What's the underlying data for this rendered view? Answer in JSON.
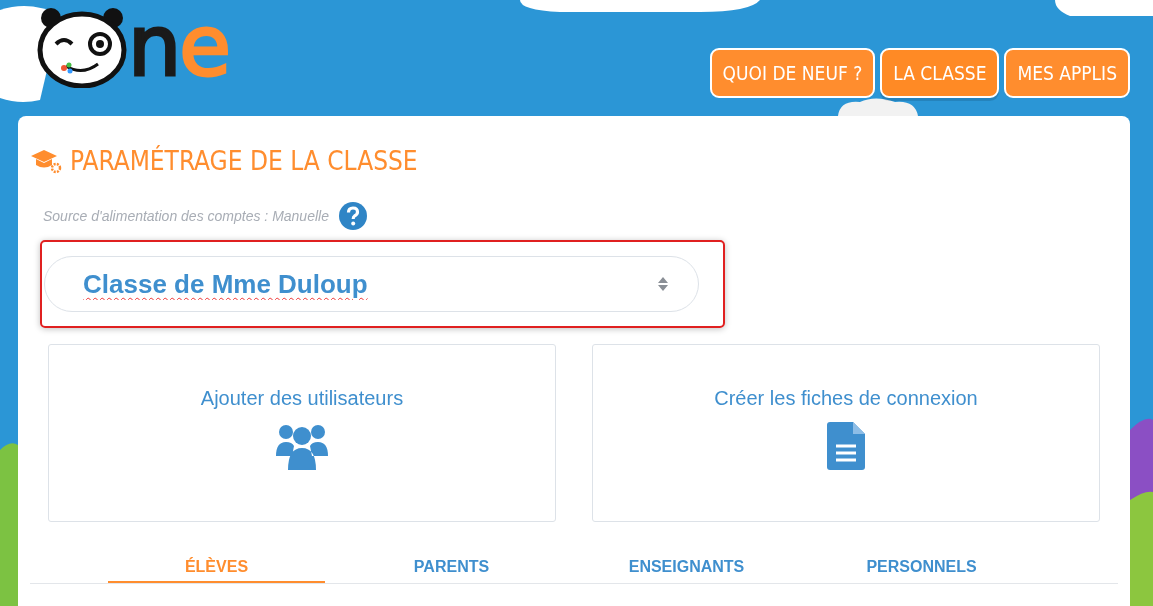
{
  "logo": {
    "letters": [
      {
        "text": "n",
        "color": "#1a1a1a"
      },
      {
        "text": "e",
        "color": "#ff8d2e"
      }
    ]
  },
  "nav": [
    {
      "label": "QUOI DE NEUF ?",
      "selected": false
    },
    {
      "label": "LA CLASSE",
      "selected": true
    },
    {
      "label": "MES APPLIS",
      "selected": false
    }
  ],
  "page": {
    "title": "PARAMÉTRAGE DE LA CLASSE",
    "source_label": "Source d'alimentation des comptes : Manuelle",
    "class_select": {
      "value": "Classe de Mme Duloup",
      "highlighted": true
    }
  },
  "actions": [
    {
      "label": "Ajouter des utilisateurs",
      "kind": "users"
    },
    {
      "label": "Créer les fiches de connexion",
      "kind": "document"
    }
  ],
  "tabs": [
    {
      "label": "ÉLÈVES",
      "selected": true
    },
    {
      "label": "PARENTS",
      "selected": false
    },
    {
      "label": "ENSEIGNANTS",
      "selected": false
    },
    {
      "label": "PERSONNELS",
      "selected": false
    }
  ]
}
